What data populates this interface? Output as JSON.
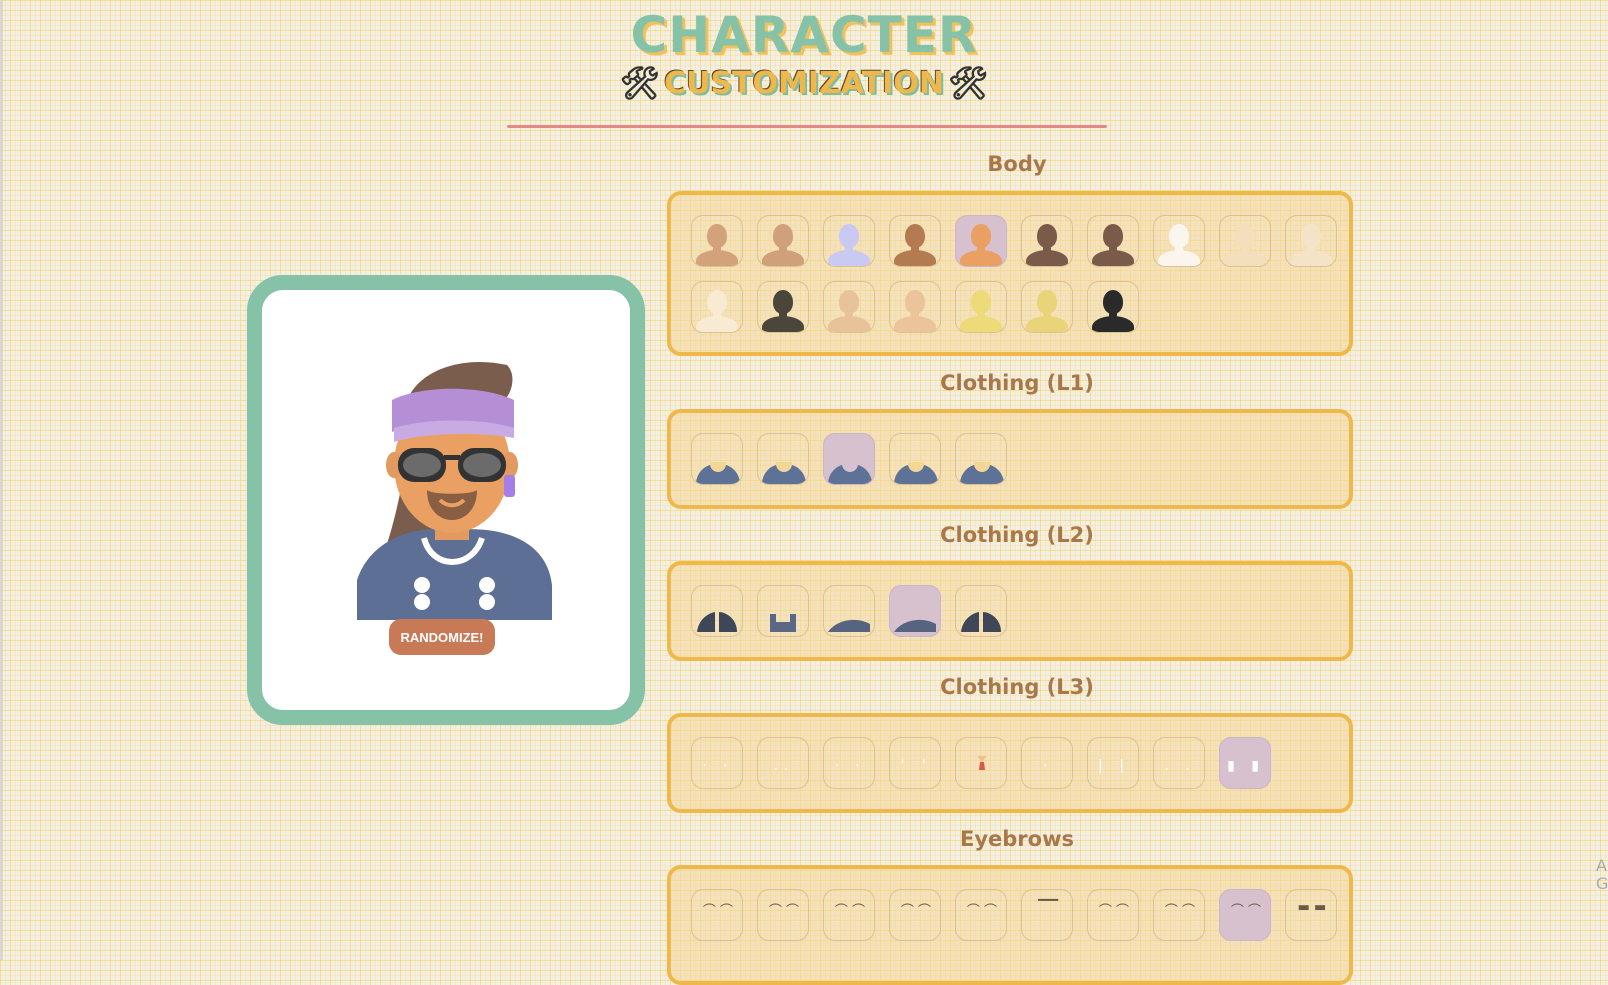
{
  "header": {
    "title": "CHARACTER",
    "subtitle": "CUSTOMIZATION",
    "tool_icon": "🛠"
  },
  "preview": {
    "randomize_label": "RANDOMIZE!"
  },
  "sections": {
    "body": {
      "title": "Body",
      "options": [
        {
          "color": "#d4a27a",
          "selected": false
        },
        {
          "color": "#d0a07a",
          "selected": false
        },
        {
          "color": "#c9c9f4",
          "selected": false
        },
        {
          "color": "#b47b52",
          "selected": false
        },
        {
          "color": "#e9a062",
          "selected": true
        },
        {
          "color": "#7a5a48",
          "selected": false
        },
        {
          "color": "#7a5a48",
          "selected": false
        },
        {
          "color": "#faf6ee",
          "selected": false
        },
        {
          "color": "#f4dfbc",
          "selected": false
        },
        {
          "color": "#f4e3c6",
          "selected": false
        },
        {
          "color": "#f8ead3",
          "selected": false
        },
        {
          "color": "#4a463c",
          "selected": false
        },
        {
          "color": "#e8c39a",
          "selected": false
        },
        {
          "color": "#ebc49c",
          "selected": false
        },
        {
          "color": "#ecdb78",
          "selected": false
        },
        {
          "color": "#e9d47a",
          "selected": false
        },
        {
          "color": "#2a2a2a",
          "selected": false
        }
      ]
    },
    "clothing_l1": {
      "title": "Clothing (L1)",
      "options": [
        {
          "selected": false
        },
        {
          "selected": false
        },
        {
          "selected": true
        },
        {
          "selected": false
        },
        {
          "selected": false
        }
      ]
    },
    "clothing_l2": {
      "title": "Clothing (L2)",
      "options": [
        {
          "selected": false
        },
        {
          "selected": false
        },
        {
          "selected": false
        },
        {
          "selected": true
        },
        {
          "selected": false
        }
      ]
    },
    "clothing_l3": {
      "title": "Clothing (L3)",
      "options": [
        {
          "selected": false
        },
        {
          "selected": false
        },
        {
          "selected": false
        },
        {
          "selected": false
        },
        {
          "selected": false
        },
        {
          "selected": false
        },
        {
          "selected": false
        },
        {
          "selected": false
        },
        {
          "selected": true
        }
      ]
    },
    "eyebrows": {
      "title": "Eyebrows",
      "options": [
        {
          "selected": false
        },
        {
          "selected": false
        },
        {
          "selected": false
        },
        {
          "selected": false
        },
        {
          "selected": false
        },
        {
          "selected": false
        },
        {
          "selected": false
        },
        {
          "selected": false
        },
        {
          "selected": true
        },
        {
          "selected": false
        }
      ]
    }
  },
  "edge_text": "A G"
}
